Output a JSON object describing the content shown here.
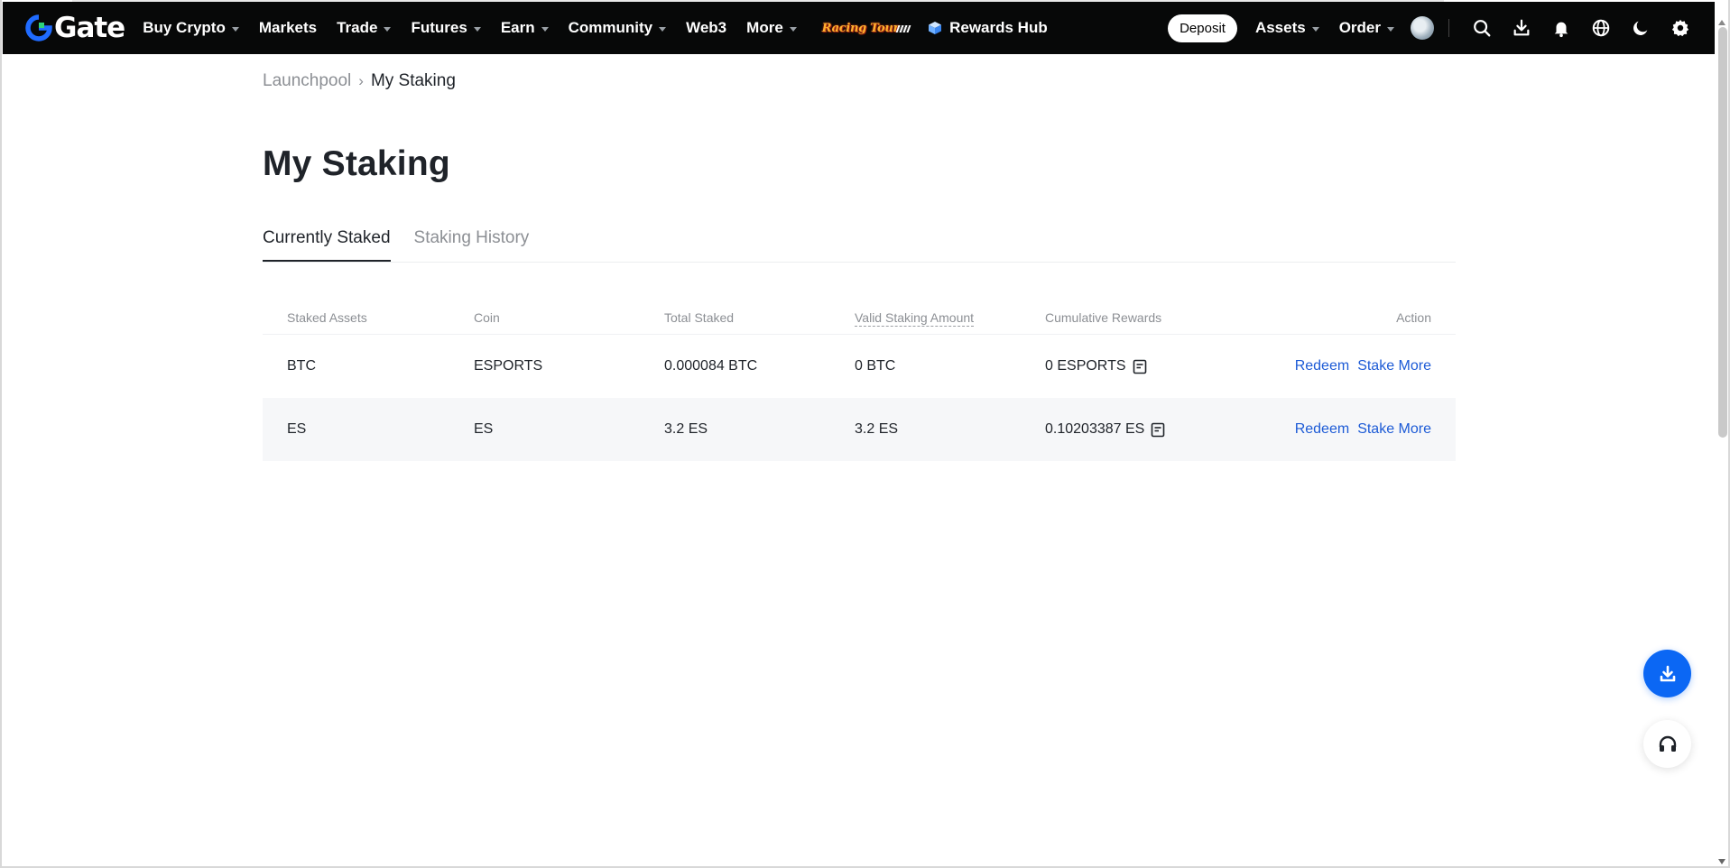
{
  "nav": {
    "logo_text": "Gate",
    "items": [
      {
        "label": "Buy Crypto",
        "dropdown": true
      },
      {
        "label": "Markets",
        "dropdown": false
      },
      {
        "label": "Trade",
        "dropdown": true
      },
      {
        "label": "Futures",
        "dropdown": true
      },
      {
        "label": "Earn",
        "dropdown": true
      },
      {
        "label": "Community",
        "dropdown": true
      },
      {
        "label": "Web3",
        "dropdown": false
      },
      {
        "label": "More",
        "dropdown": true
      }
    ],
    "promo_text": "Racing Tour",
    "rewards_label": "Rewards Hub",
    "deposit_label": "Deposit",
    "assets_label": "Assets",
    "order_label": "Order",
    "icons": [
      "search-icon",
      "download-icon",
      "bell-icon",
      "globe-icon",
      "moon-icon",
      "gear-icon"
    ],
    "background_color": "#070808"
  },
  "breadcrumb": {
    "parent": "Launchpool",
    "separator": "›",
    "current": "My Staking"
  },
  "page": {
    "title": "My Staking"
  },
  "tabs": [
    {
      "label": "Currently Staked",
      "active": true
    },
    {
      "label": "Staking History",
      "active": false
    }
  ],
  "table": {
    "headers": {
      "staked_assets": "Staked Assets",
      "coin": "Coin",
      "total_staked": "Total Staked",
      "valid_staking_amount": "Valid Staking Amount",
      "cumulative_rewards": "Cumulative Rewards",
      "action": "Action"
    },
    "rows": [
      {
        "staked_asset": "BTC",
        "coin": "ESPORTS",
        "total_staked": "0.000084 BTC",
        "valid_staking_amount": "0 BTC",
        "cumulative_rewards": "0 ESPORTS",
        "redeem_label": "Redeem",
        "stake_more_label": "Stake More"
      },
      {
        "staked_asset": "ES",
        "coin": "ES",
        "total_staked": "3.2 ES",
        "valid_staking_amount": "3.2 ES",
        "cumulative_rewards": "0.10203387 ES",
        "redeem_label": "Redeem",
        "stake_more_label": "Stake More"
      }
    ]
  },
  "colors": {
    "link": "#1d5bd6",
    "fab": "#0b67f4",
    "text_primary": "#1f2329",
    "text_muted": "#8c8f94"
  }
}
